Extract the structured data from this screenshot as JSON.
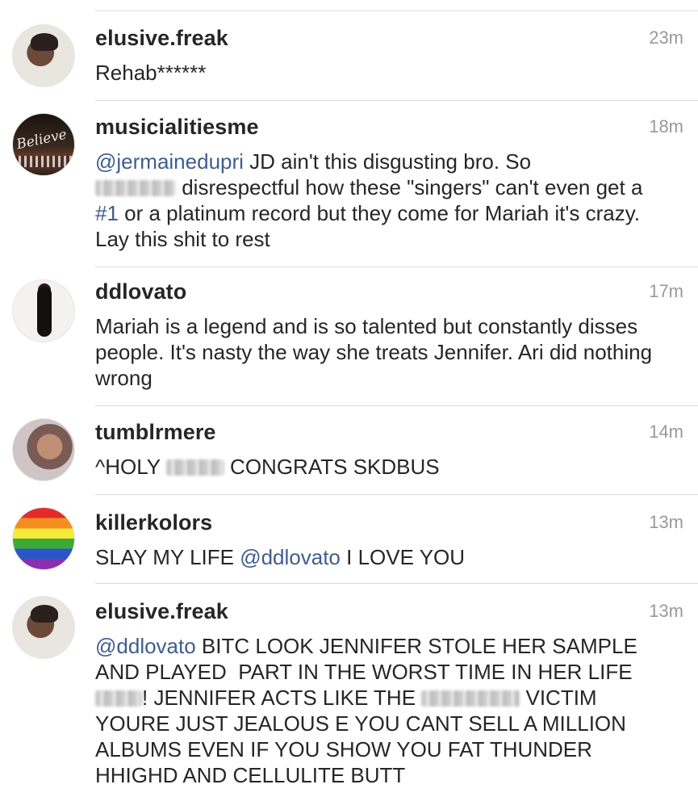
{
  "comments": [
    {
      "username": "elusive.freak",
      "time": "23m",
      "text": "Rehab******",
      "avatar": "avatar-photo"
    },
    {
      "username": "musicialitiesme",
      "time": "18m",
      "mention": "@jermainedupri",
      "text_a": " JD ain't this disgusting bro. So",
      "text_b": " disrespectful how these \"singers\" can't even get a ",
      "hashtag": "#1",
      "text_c": " or a platinum record but they come for Mariah it's crazy. Lay this shit to rest",
      "avatar_script": "Believe"
    },
    {
      "username": "ddlovato",
      "time": "17m",
      "text": "Mariah is a legend and is so talented but constantly disses people. It's nasty the way she treats Jennifer. Ari did nothing wrong"
    },
    {
      "username": "tumblrmere",
      "time": "14m",
      "text_a": "^HOLY ",
      "text_b": " CONGRATS SKDBUS"
    },
    {
      "username": "killerkolors",
      "time": "13m",
      "text_a": "SLAY MY LIFE ",
      "mention": "@ddlovato",
      "text_b": " I LOVE YOU"
    },
    {
      "username": "elusive.freak",
      "time": "13m",
      "mention": "@ddlovato",
      "text_a": " BITC LOOK JENNIFER STOLE HER SAMPLE AND PLAYED  PART IN THE WORST TIME IN HER LIFE ",
      "text_b": "! JENNIFER ACTS LIKE THE ",
      "text_c": " VICTIM YOURE JUST JEALOUS E YOU CANT SELL A MILLION ALBUMS EVEN IF YOU SHOW YOU FAT THUNDER HHIGHD AND CELLULITE BUTT"
    }
  ],
  "colors": {
    "mention": "#3f5d8f",
    "timestamp": "#999999",
    "divider": "#dbdbdb"
  }
}
